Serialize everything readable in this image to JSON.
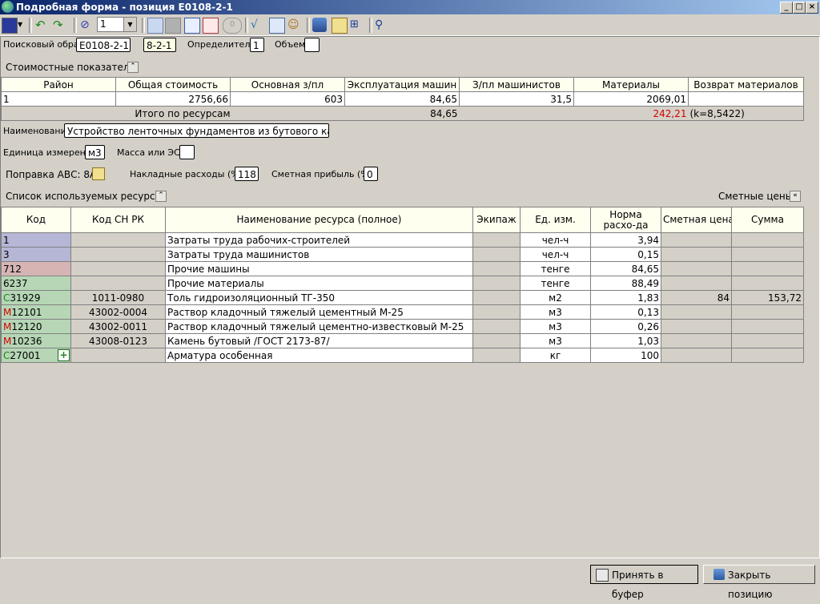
{
  "window": {
    "title": "Подробная форма - позиция E0108-2-1"
  },
  "toolbar": {
    "combo_value": "1"
  },
  "header": {
    "search_label": "Поисковый образ",
    "search_value": "E0108-2-1",
    "code_value": "8-2-1",
    "determinant_label": "Определитель",
    "determinant_value": "1",
    "volume_label": "Объем",
    "volume_value": ""
  },
  "cost": {
    "section_label": "Стоимостные показатели",
    "columns": [
      "Район",
      "Общая стоимость",
      "Основная з/пл",
      "Эксплуатация машин",
      "З/пл машинистов",
      "Материалы",
      "Возврат материалов"
    ],
    "row": [
      "1",
      "2756,66",
      "603",
      "84,65",
      "31,5",
      "2069,01",
      ""
    ],
    "total_label": "Итого по ресурсам",
    "total_machines": "84,65",
    "total_materials": "242,21",
    "total_coef": "(k=8,5422)"
  },
  "details": {
    "name_label": "Наименование",
    "name_value": "Устройство ленточных фундаментов из бутового камня",
    "unit_label": "Единица измерения",
    "unit_value": "м3",
    "mass_label": "Масса или ЭСН",
    "mass_value": "",
    "correction_label": "Поправка АВС: 8А",
    "overhead_label": "Накладные расходы (%)",
    "overhead_value": "118",
    "profit_label": "Сметная прибыль (%)",
    "profit_value": "0"
  },
  "resources": {
    "section_label": "Список используемых ресурсов",
    "prices_label": "Сметные цены",
    "columns": [
      "Код",
      "Код СН РК",
      "Наименование ресурса (полное)",
      "Экипаж",
      "Ед. изм.",
      "Норма расхо-да",
      "Сметная цена",
      "Сумма"
    ],
    "rows": [
      {
        "prefix": "",
        "code": "1",
        "snrk": "",
        "name": "Затраты труда рабочих-строителей",
        "crew": "",
        "unit": "чел-ч",
        "norm": "3,94",
        "price": "",
        "sum": ""
      },
      {
        "prefix": "",
        "code": "3",
        "snrk": "",
        "name": "Затраты труда машинистов",
        "crew": "",
        "unit": "чел-ч",
        "norm": "0,15",
        "price": "",
        "sum": ""
      },
      {
        "prefix": "",
        "code": "712",
        "snrk": "",
        "name": "Прочие машины",
        "crew": "",
        "unit": "тенге",
        "norm": "84,65",
        "price": "",
        "sum": ""
      },
      {
        "prefix": "",
        "code": "6237",
        "snrk": "",
        "name": "Прочие материалы",
        "crew": "",
        "unit": "тенге",
        "norm": "88,49",
        "price": "",
        "sum": ""
      },
      {
        "prefix": "С",
        "code": "31929",
        "snrk": "1011-0980",
        "name": "Толь гидроизоляционный ТГ-350",
        "crew": "",
        "unit": "м2",
        "norm": "1,83",
        "price": "84",
        "sum": "153,72"
      },
      {
        "prefix": "М",
        "code": "12101",
        "snrk": "43002-0004",
        "name": "Раствор кладочный тяжелый цементный М-25",
        "crew": "",
        "unit": "м3",
        "norm": "0,13",
        "price": "",
        "sum": ""
      },
      {
        "prefix": "М",
        "code": "12120",
        "snrk": "43002-0011",
        "name": "Раствор кладочный тяжелый цементно-известковый М-25",
        "crew": "",
        "unit": "м3",
        "norm": "0,26",
        "price": "",
        "sum": ""
      },
      {
        "prefix": "М",
        "code": "10236",
        "snrk": "43008-0123",
        "name": "Камень бутовый /ГОСТ 2173-87/",
        "crew": "",
        "unit": "м3",
        "norm": "1,03",
        "price": "",
        "sum": ""
      },
      {
        "prefix": "С",
        "code": "27001",
        "snrk": "",
        "name": "Арматура особенная",
        "crew": "",
        "unit": "кг",
        "norm": "100",
        "price": "",
        "sum": ""
      }
    ]
  },
  "footer": {
    "accept_label": "Принять в буфер",
    "close_label": "Закрыть позицию"
  },
  "colors": {
    "labor": "#b6b6d6",
    "machines": "#d6b4b4",
    "materials": "#b6d6b6",
    "accent_red": "#d00000"
  }
}
